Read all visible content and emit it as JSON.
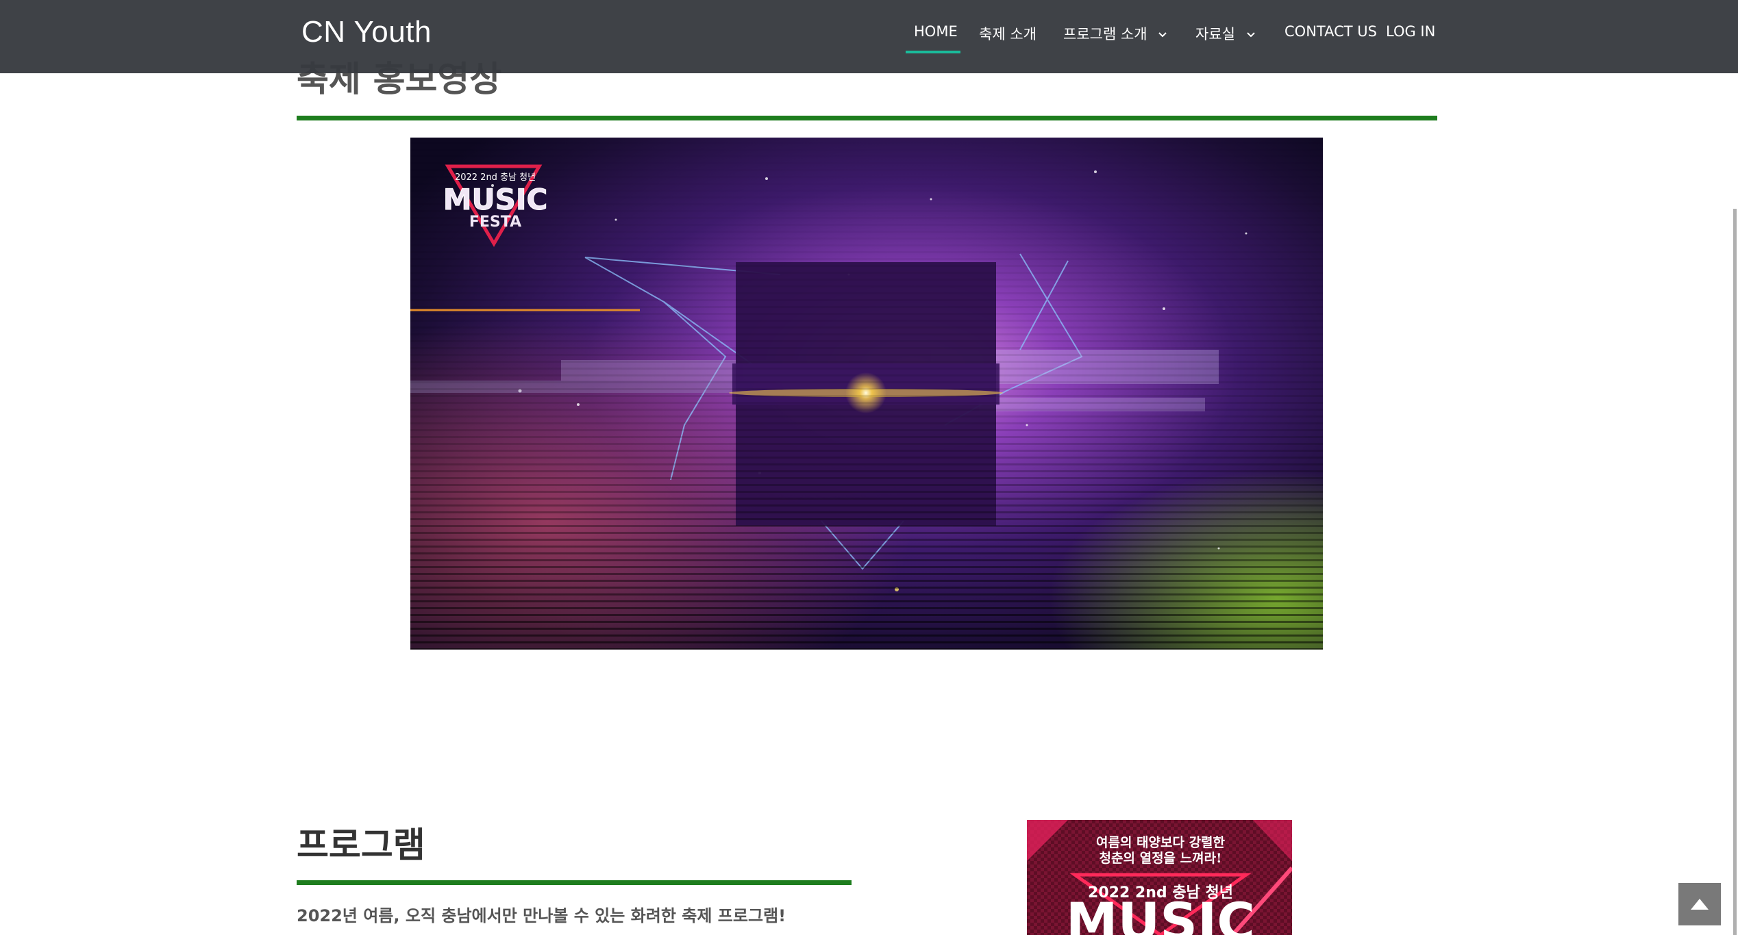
{
  "header": {
    "brand": "CN Youth",
    "nav": [
      {
        "label": "HOME",
        "active": true
      },
      {
        "label": "축제 소개"
      },
      {
        "label": "프로그램 소개",
        "dropdown": true
      },
      {
        "label": "자료실",
        "dropdown": true
      },
      {
        "label": "CONTACT US"
      },
      {
        "label": "LOG IN"
      }
    ]
  },
  "promo": {
    "title": "축제 홍보영상",
    "video_logo_top": "2022 2nd 충남 청년",
    "video_logo_main": "MUSIC",
    "video_logo_sub": "FESTA"
  },
  "program": {
    "title": "프로그램",
    "subtitle": "2022년 여름, 오직 충남에서만 만나볼 수 있는 화려한 축제 프로그램!",
    "poster_line1": "여름의 태양보다 강렬한",
    "poster_line2": "청춘의 열정을 느껴라!",
    "poster_line3": "2022 2nd 충남 청년",
    "poster_line4": "MUSIC"
  },
  "colors": {
    "accent": "#1abc9c",
    "divider": "#1e7d1e",
    "navbar": "#373a40"
  },
  "icons": {
    "dropdown": "chevron-down-icon",
    "scroll_top": "arrow-up-icon"
  }
}
